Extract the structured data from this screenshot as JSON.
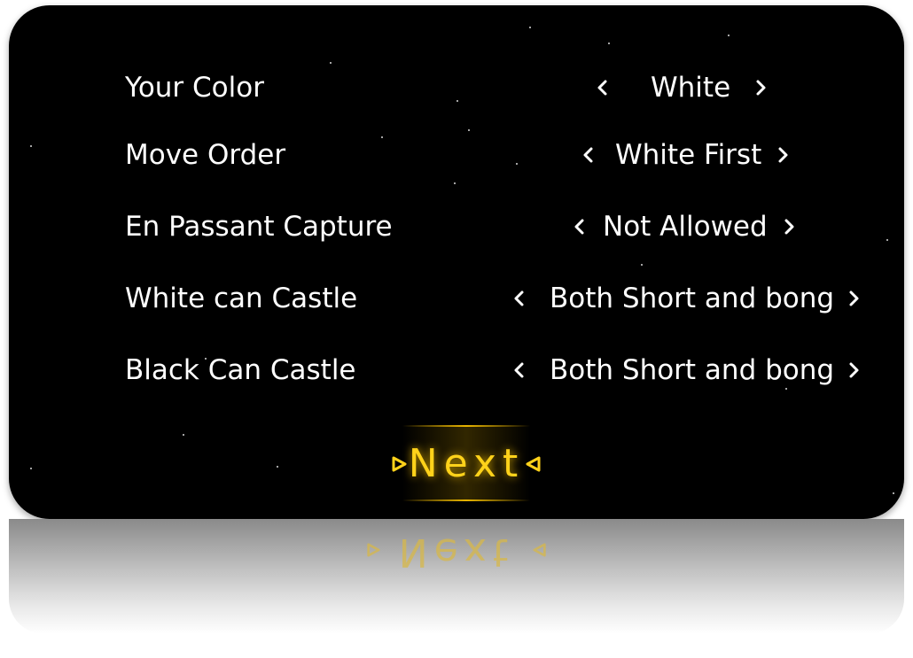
{
  "settings": {
    "rows": [
      {
        "label": "Your Color",
        "value": "White"
      },
      {
        "label": "Move Order",
        "value": "White First"
      },
      {
        "label": "En Passant Capture",
        "value": "Not Allowed"
      },
      {
        "label": "White can Castle",
        "value": "Both Short and bong"
      },
      {
        "label": "Black Can Castle",
        "value": "Both Short and bong"
      }
    ]
  },
  "next_button": {
    "label": "Next"
  },
  "colors": {
    "panel_bg": "#000000",
    "text": "#ffffff",
    "accent": "#ffd21a"
  },
  "icons": {
    "prev": "chevron-left-icon",
    "next": "chevron-right-icon",
    "next_decor": "triangle-icon"
  }
}
